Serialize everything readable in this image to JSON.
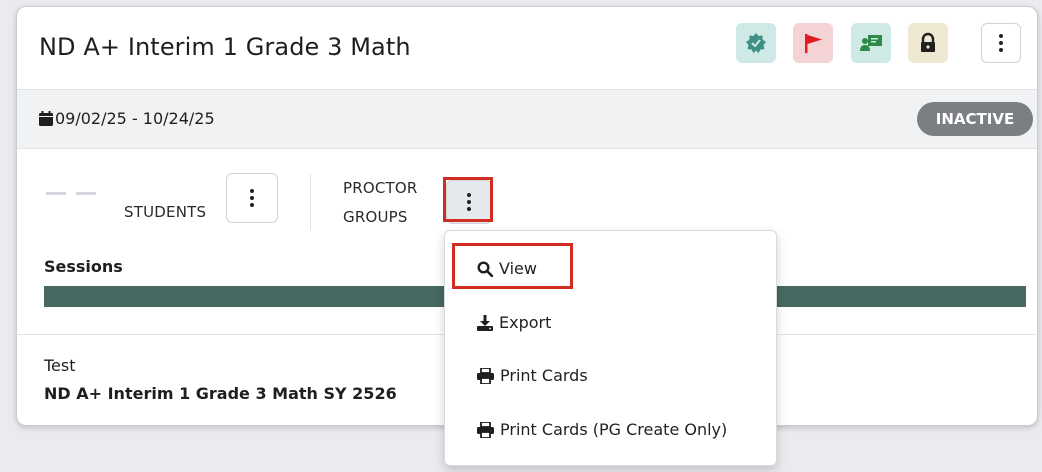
{
  "header": {
    "title": "ND A+ Interim 1 Grade 3 Math",
    "icons": [
      {
        "name": "verified-badge-icon",
        "bg": "#cfe9e6",
        "color": "#3f8f84"
      },
      {
        "name": "flag-icon",
        "bg": "#f3d3d3",
        "color": "#e21b22"
      },
      {
        "name": "proctor-icon",
        "bg": "#cfe9e6",
        "color": "#2f8a4a"
      },
      {
        "name": "lock-icon",
        "bg": "#efe8d2",
        "color": "#1f1f1f"
      }
    ]
  },
  "date_row": {
    "date_range": "09/02/25 - 10/24/25",
    "status": "INACTIVE"
  },
  "groups": {
    "students_label": "STUDENTS",
    "proctor_label_line1": "PROCTOR",
    "proctor_label_line2": "GROUPS"
  },
  "sessions": {
    "label": "Sessions",
    "bar_color": "#466a62"
  },
  "test": {
    "label": "Test",
    "value": "ND A+ Interim 1 Grade 3 Math SY 2526"
  },
  "dropdown_menu": {
    "items": [
      {
        "label": "View",
        "icon": "search-icon"
      },
      {
        "label": "Export",
        "icon": "download-icon"
      },
      {
        "label": "Print Cards",
        "icon": "printer-icon"
      },
      {
        "label": "Print Cards (PG Create Only)",
        "icon": "printer-icon"
      }
    ]
  },
  "colors": {
    "highlight": "#d12d22",
    "badge_bg": "#7b7f83"
  }
}
